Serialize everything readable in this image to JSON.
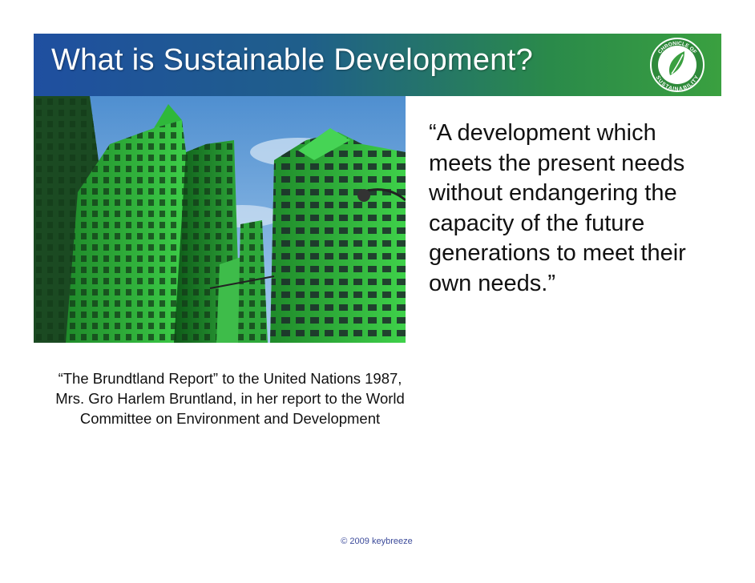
{
  "slide": {
    "title": "What is Sustainable Development?",
    "logo_text_top": "CHRONICLE OF",
    "logo_text_bottom": "SUSTAINABILITY",
    "quote": "“A development which meets the present needs without endangering the capacity of the future generations to meet their own needs.”",
    "citation": "“The Brundtland Report” to the United Nations 1987, Mrs. Gro Harlem Bruntland, in her report to the World Committee on Environment and Development",
    "footer": "© 2009 keybreeze"
  },
  "image": {
    "icon": "green-skyscrapers-photo"
  },
  "colors": {
    "title_gradient_start": "#1f4fa0",
    "title_gradient_end": "#3aa040",
    "title_text": "#ffffff",
    "footer_text": "#3b4a9a"
  }
}
